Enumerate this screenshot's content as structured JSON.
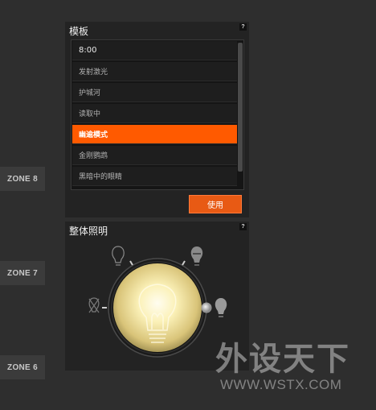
{
  "zones": [
    {
      "label": "ZONE 8"
    },
    {
      "label": "ZONE 7"
    },
    {
      "label": "ZONE 6"
    }
  ],
  "templates_panel": {
    "title": "模板",
    "help": "?",
    "items": [
      {
        "label": "8:00",
        "selected": false
      },
      {
        "label": "发射激光",
        "selected": false
      },
      {
        "label": "护城河",
        "selected": false
      },
      {
        "label": "读取中",
        "selected": false
      },
      {
        "label": "幽逾模式",
        "selected": true
      },
      {
        "label": "金刚鹦鹉",
        "selected": false
      },
      {
        "label": "黑暗中的眼睛",
        "selected": false
      }
    ],
    "use_button": "使用"
  },
  "lighting_panel": {
    "title": "整体照明",
    "help": "?",
    "brightness_level": 1.0,
    "icons": [
      "bulb-outline-icon",
      "bulb-dim-icon",
      "bulb-off-icon",
      "bulb-bright-icon"
    ]
  },
  "watermark": {
    "chinese": "外设天下",
    "url": "WWW.WSTX.COM"
  },
  "colors": {
    "background": "#2e2e2e",
    "panel": "#232323",
    "accent": "#ff5a00"
  }
}
